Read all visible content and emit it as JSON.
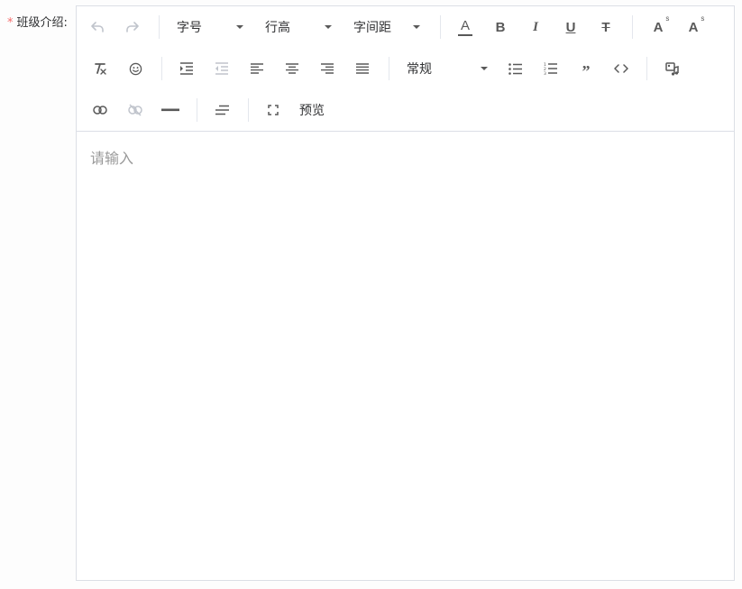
{
  "form": {
    "required_mark": "*",
    "label": "班级介绍:"
  },
  "toolbar": {
    "font_size_label": "字号",
    "line_height_label": "行高",
    "letter_spacing_label": "字间距",
    "paragraph_style_label": "常规",
    "preview_label": "预览",
    "font_color_glyph": "A",
    "bold_glyph": "B",
    "italic_glyph": "I",
    "underline_glyph": "U",
    "strike_glyph": "T",
    "superscript_glyph": "A",
    "superscript_mark": "s",
    "subscript_glyph": "A",
    "subscript_mark": "s",
    "quote_glyph": "”",
    "code_glyph": "<>",
    "icons": {
      "undo": "undo-icon",
      "redo": "redo-icon",
      "clear_format": "clear-format-icon",
      "emoji": "emoji-icon",
      "indent": "indent-icon",
      "outdent": "outdent-icon",
      "align_left": "align-left-icon",
      "align_center": "align-center-icon",
      "align_right": "align-right-icon",
      "align_justify": "align-justify-icon",
      "bullet_list": "bullet-list-icon",
      "ordered_list": "ordered-list-icon",
      "media": "media-icon",
      "link": "link-icon",
      "unlink": "unlink-icon",
      "hr": "horizontal-rule-icon",
      "text_indent": "text-indent-icon",
      "fullscreen": "fullscreen-icon"
    }
  },
  "editor": {
    "placeholder": "请输入"
  },
  "colors": {
    "required": "#f56c6c",
    "border": "#dcdfe6",
    "icon": "#595959",
    "disabled_icon": "#c0c4cc",
    "placeholder": "#999999"
  }
}
